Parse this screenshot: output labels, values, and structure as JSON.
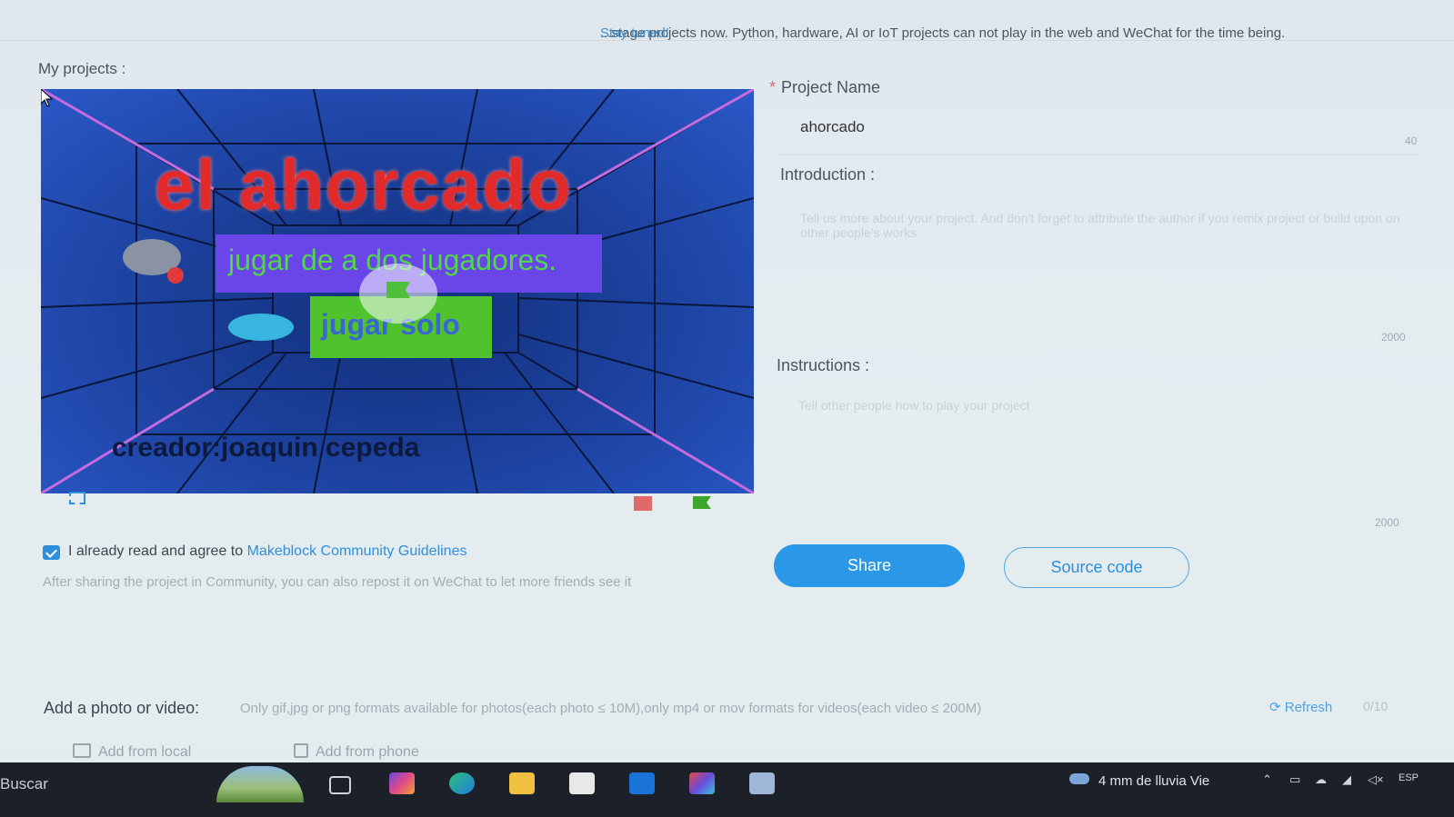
{
  "notice": {
    "text": "...stage projects now. Python, hardware, AI or IoT projects can not play in the web and WeChat for the time being.",
    "stay_tuned": "Stay tuned!"
  },
  "my_projects_label": "My projects :",
  "stage": {
    "title": "el ahorcado",
    "two_players_button": "jugar de a dos jugadores.",
    "solo_button": "jugar solo",
    "creator": "creador:joaquin cepeda"
  },
  "stage_controls": {
    "fullscreen_icon": "fullscreen-icon",
    "stop_icon": "stop-icon",
    "green_flag_icon": "green-flag-icon"
  },
  "agreement": {
    "checked": true,
    "text": "I already read and agree to",
    "link": "Makeblock Community Guidelines",
    "hint": "After sharing the project in Community, you can also repost it on WeChat to let more friends see it"
  },
  "form": {
    "project_name": {
      "label": "Project Name",
      "required_mark": "*",
      "value": "ahorcado",
      "max": "40"
    },
    "introduction": {
      "label": "Introduction :",
      "placeholder": "Tell us more about your project. And don't forget to attribute the author if you remix project or build upon on other people's works",
      "max": "2000"
    },
    "instructions": {
      "label": "Instructions :",
      "placeholder": "Tell other people how to play your project",
      "max": "2000"
    }
  },
  "buttons": {
    "share": "Share",
    "source_code": "Source code"
  },
  "media": {
    "label": "Add a photo or video:",
    "hint": "Only gif,jpg or png formats available for photos(each photo ≤ 10M),only mp4 or mov formats for videos(each video ≤ 200M)",
    "refresh": "Refresh",
    "count": "0/10",
    "add_local": "Add from local",
    "add_phone": "Add from phone"
  },
  "taskbar": {
    "search": "Buscar",
    "weather": "4 mm de lluvia Vie",
    "language": "ESP"
  },
  "colors": {
    "accent": "#2a98e6",
    "required": "#e06a6a"
  }
}
